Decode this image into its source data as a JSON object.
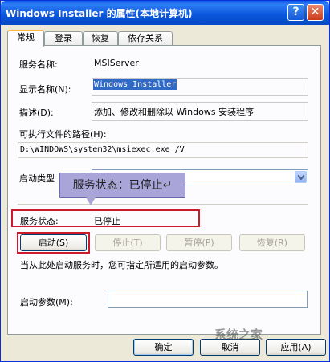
{
  "window": {
    "title": "Windows Installer 的属性(本地计算机)",
    "help_glyph": "?",
    "close_glyph": "✕"
  },
  "tabs": [
    {
      "label": "常规",
      "active": true
    },
    {
      "label": "登录",
      "active": false
    },
    {
      "label": "恢复",
      "active": false
    },
    {
      "label": "依存关系",
      "active": false
    }
  ],
  "general": {
    "service_name_label": "服务名称:",
    "service_name_value": "MSIServer",
    "display_name_label": "显示名称(N):",
    "display_name_value": "Windows Installer",
    "description_label": "描述(D):",
    "description_value": "添加、修改和删除以 Windows 安装程序",
    "exec_path_label": "可执行文件的路径(H):",
    "exec_path_value": "D:\\WINDOWS\\system32\\msiexec.exe /V",
    "startup_type_label": "启动类型",
    "startup_type_value": "",
    "status_label": "服务状态:",
    "status_value": "已停止",
    "buttons": {
      "start": "启动(S)",
      "stop": "停止(T)",
      "pause": "暂停(P)",
      "resume": "恢复(R)"
    },
    "hint": "当从此处启动服务时，您可指定所适用的启动参数。",
    "start_params_label": "启动参数(M):",
    "start_params_value": ""
  },
  "callout": {
    "text": "服务状态：已停止↵"
  },
  "footer": {
    "ok": "确定",
    "cancel": "取消",
    "apply": "应用(A)"
  },
  "watermark": {
    "text": "系统之家"
  },
  "colors": {
    "title_bar": "#0a5ee8",
    "highlight_box": "#cc1b2a",
    "callout_bg": "#a9a5d8",
    "selection": "#316ac5"
  }
}
